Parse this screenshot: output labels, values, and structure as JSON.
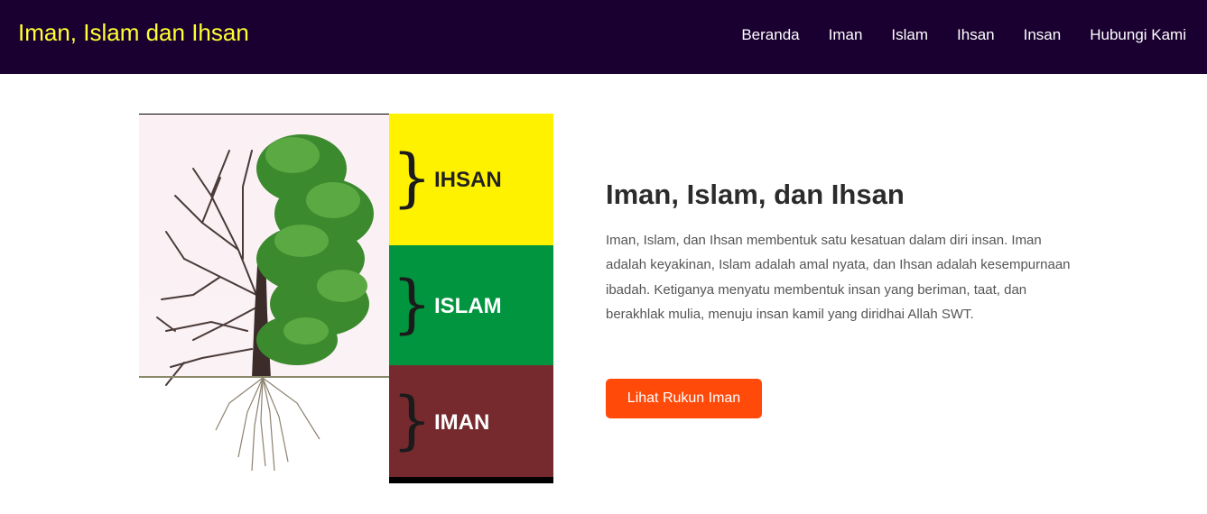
{
  "header": {
    "brand": "Iman, Islam dan Ihsan",
    "nav": [
      "Beranda",
      "Iman",
      "Islam",
      "Ihsan",
      "Insan",
      "Hubungi Kami"
    ]
  },
  "hero_image": {
    "bands": [
      {
        "label": "IHSAN",
        "color": "#fff200",
        "text_color": "#222222"
      },
      {
        "label": "ISLAM",
        "color": "#019540",
        "text_color": "#ffffff"
      },
      {
        "label": "IMAN",
        "color": "#772a2d",
        "text_color": "#ffffff"
      }
    ],
    "brace": "}"
  },
  "main": {
    "title": "Iman, Islam, dan Ihsan",
    "description": "Iman, Islam, dan Ihsan membentuk satu kesatuan dalam diri insan. Iman adalah keyakinan, Islam adalah amal nyata, dan Ihsan adalah kesempurnaan ibadah. Ketiganya menyatu membentuk insan yang beriman, taat, dan berakhlak mulia, menuju insan kamil yang diridhai Allah SWT.",
    "button_label": "Lihat Rukun Iman",
    "button_color": "#ff4a0a"
  },
  "colors": {
    "navbar_bg": "#1a0030",
    "brand": "#ffff33"
  }
}
